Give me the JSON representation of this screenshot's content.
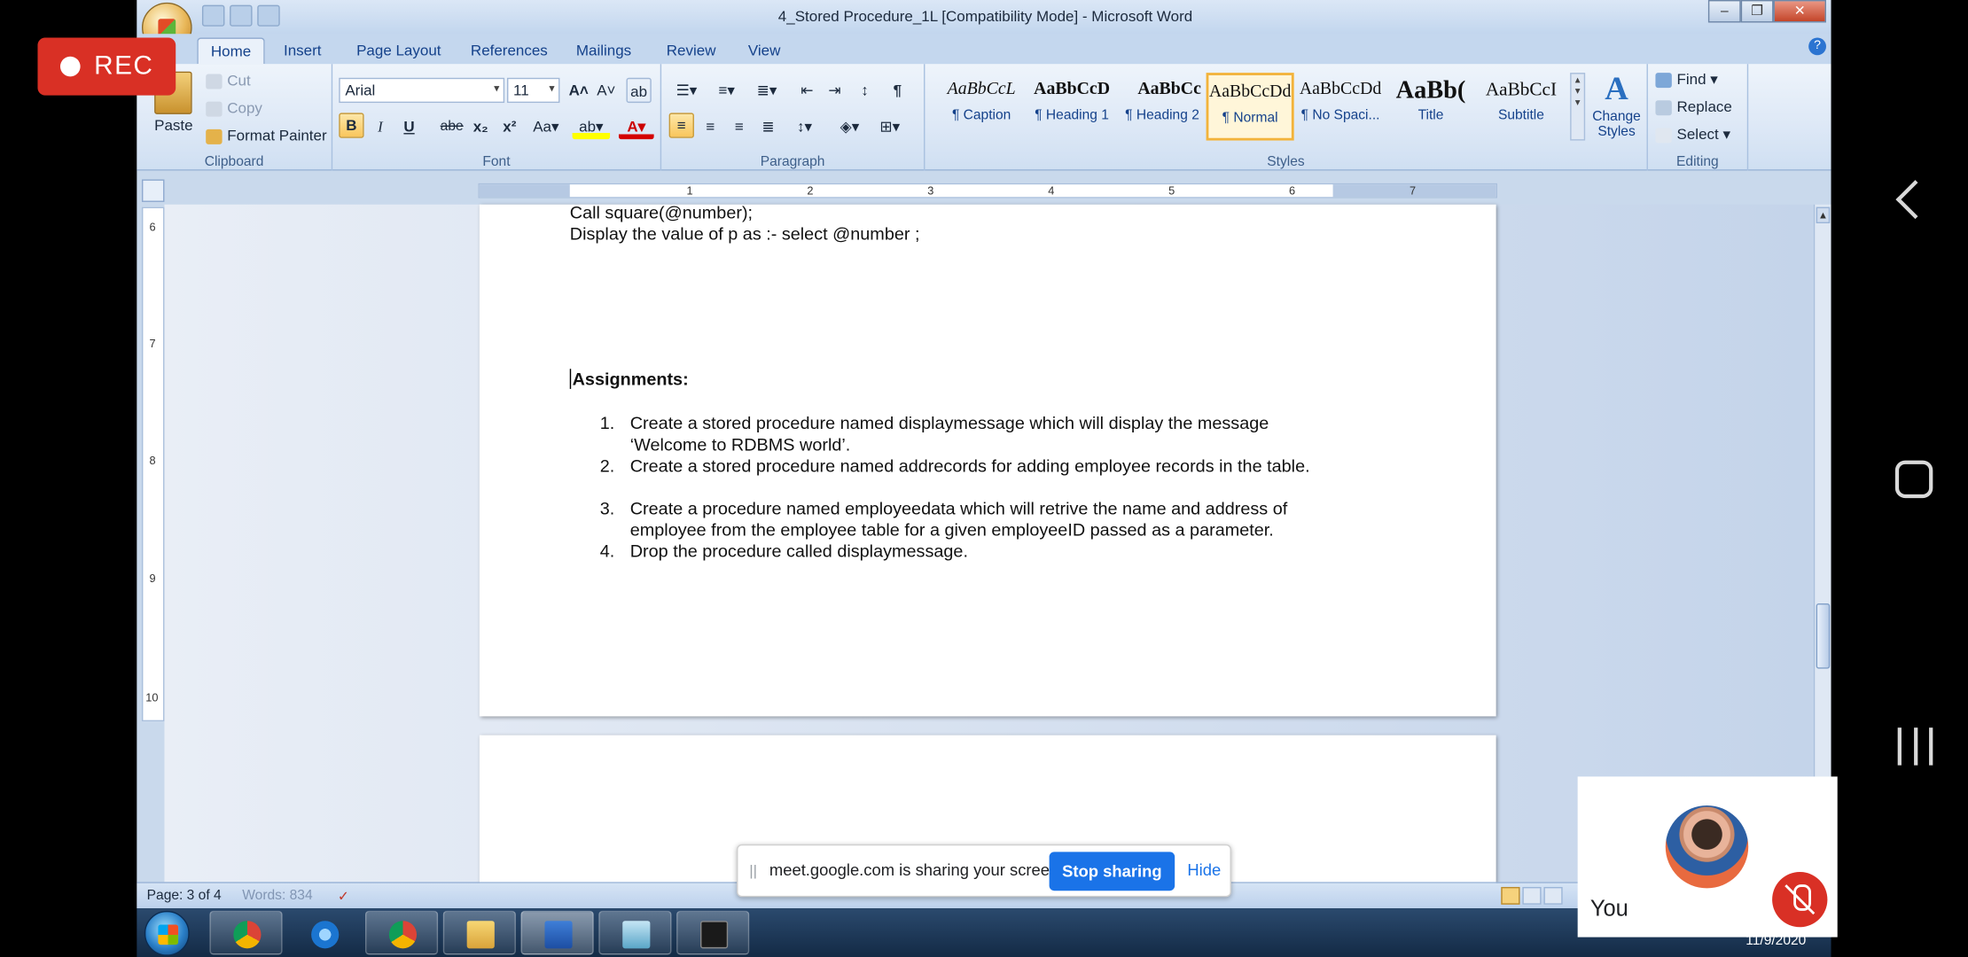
{
  "word": {
    "title": "4_Stored Procedure_1L [Compatibility Mode] - Microsoft Word",
    "tabs": [
      "Home",
      "Insert",
      "Page Layout",
      "References",
      "Mailings",
      "Review",
      "View"
    ],
    "active_tab": "Home",
    "clipboard": {
      "paste": "Paste",
      "cut": "Cut",
      "copy": "Copy",
      "format_painter": "Format Painter",
      "label": "Clipboard"
    },
    "font": {
      "name": "Arial",
      "size": "11",
      "label": "Font"
    },
    "paragraph": {
      "label": "Paragraph"
    },
    "styles": {
      "label": "Styles",
      "items": [
        {
          "sample": "AaBbCcL",
          "name": "¶ Caption"
        },
        {
          "sample": "AaBbCcD",
          "name": "¶ Heading 1"
        },
        {
          "sample": "AaBbCc",
          "name": "¶ Heading 2"
        },
        {
          "sample": "AaBbCcDd",
          "name": "¶ Normal"
        },
        {
          "sample": "AaBbCcDd",
          "name": "¶ No Spaci..."
        },
        {
          "sample": "AaBb(",
          "name": "Title"
        },
        {
          "sample": "AaBbCcI",
          "name": "Subtitle"
        }
      ],
      "selected": "¶ Normal",
      "change_styles": "Change Styles"
    },
    "editing": {
      "label": "Editing",
      "find": "Find",
      "replace": "Replace",
      "select": "Select"
    },
    "document": {
      "line1": "Call square(@number);",
      "line2": "Display the  value of p as  :- select @number ;",
      "heading": "Assignments:",
      "items": [
        {
          "num": "1.",
          "text": "Create a  stored  procedure named displaymessage   which will display  the message ‘Welcome to RDBMS world’."
        },
        {
          "num": "2.",
          "text": "Create a  stored  procedure named addrecords   for adding   employee  records in the table."
        },
        {
          "num": "3.",
          "text": "Create a procedure named employeedata which will retrive the name and address  of employee from the employee table  for a given employeeID passed  as a parameter."
        },
        {
          "num": "4.",
          "text": "Drop the procedure called displaymessage."
        }
      ]
    },
    "status": {
      "page": "Page: 3 of 4",
      "words": "Words: 834"
    }
  },
  "meet": {
    "rec_label": "REC",
    "share_message": "meet.google.com is sharing your screen.",
    "stop_sharing": "Stop sharing",
    "hide": "Hide",
    "self_label": "You"
  },
  "taskbar": {
    "clock": "11/9/2020"
  }
}
